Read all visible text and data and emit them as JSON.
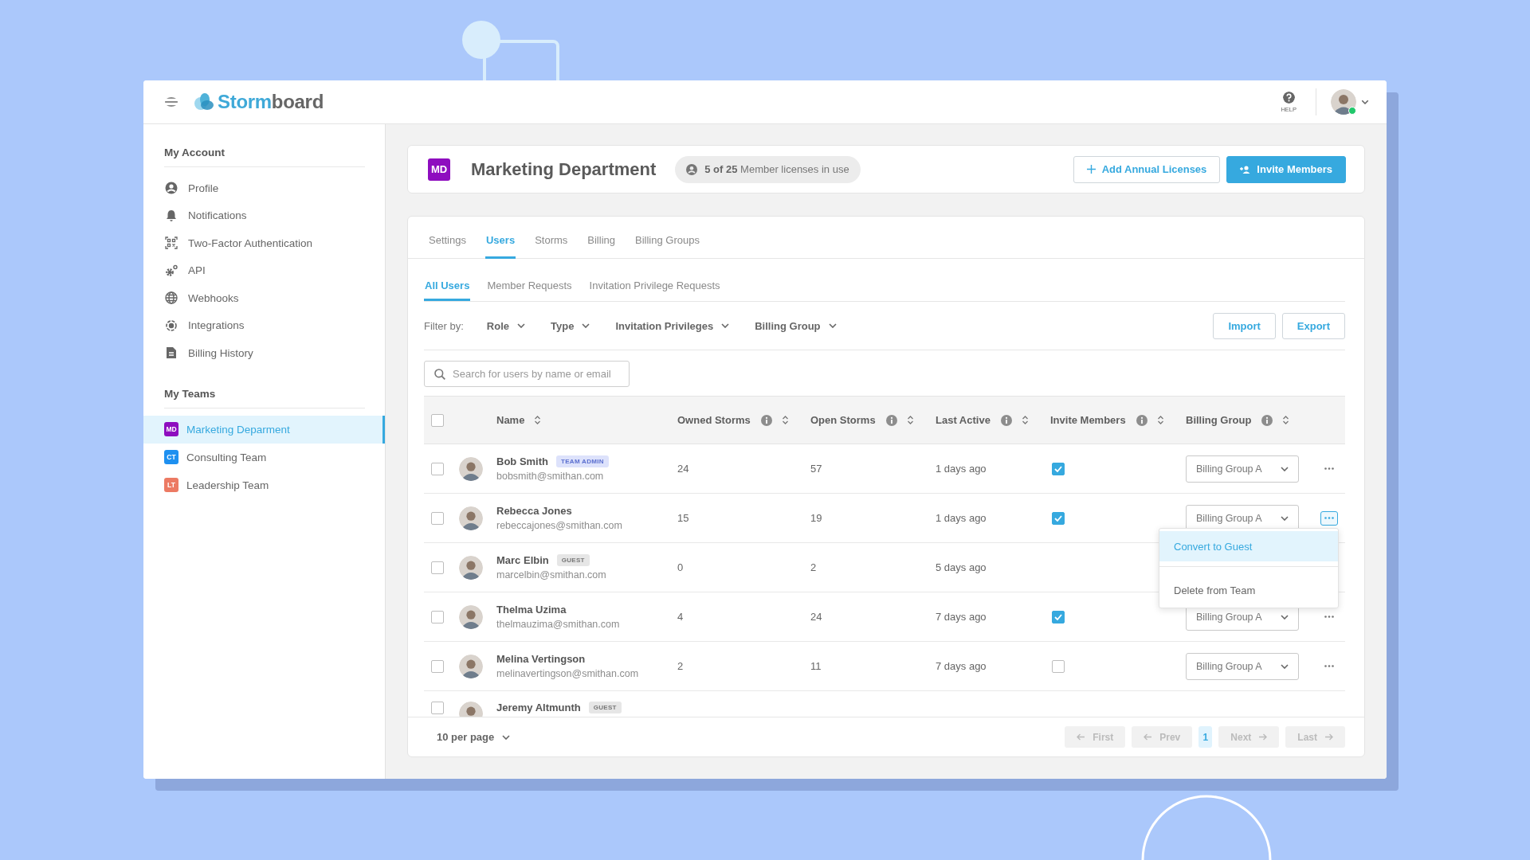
{
  "header": {
    "logo": {
      "parts": [
        {
          "text": "Storm",
          "kind": "accent"
        },
        {
          "text": "board",
          "kind": "plain"
        }
      ]
    },
    "help": {
      "label": "HELP"
    },
    "user": {
      "online": true
    }
  },
  "sidebar": {
    "account": {
      "title": "My Account",
      "items": [
        {
          "label": "Profile"
        },
        {
          "label": "Notifications"
        },
        {
          "label": "Two-Factor Authentication"
        },
        {
          "label": "API"
        },
        {
          "label": "Webhooks"
        },
        {
          "label": "Integrations"
        },
        {
          "label": "Billing History"
        }
      ]
    },
    "teams": {
      "title": "My Teams",
      "items": [
        {
          "initials": "MD",
          "label": "Marketing Deparment",
          "color": "#8e0dbf",
          "selected": true
        },
        {
          "initials": "CT",
          "label": "Consulting Team",
          "color": "#1e90f0",
          "selected": false
        },
        {
          "initials": "LT",
          "label": "Leadership Team",
          "color": "#ec7a63",
          "selected": false
        }
      ]
    }
  },
  "team": {
    "initials": "MD",
    "color": "#8e0dbf",
    "title": "Marketing Department",
    "licenses": "**5 of 25** Member licenses in use",
    "buttons": [
      {
        "label": "Add Annual Licenses",
        "kind": "outline"
      },
      {
        "label": "Invite Members",
        "kind": "primary"
      }
    ]
  },
  "tabs": [
    {
      "label": "Settings",
      "selected": false
    },
    {
      "label": "Users",
      "selected": true
    },
    {
      "label": "Storms",
      "selected": false
    },
    {
      "label": "Billing",
      "selected": false
    },
    {
      "label": "Billing Groups",
      "selected": false
    }
  ],
  "subtabs": [
    {
      "label": "All Users",
      "selected": true
    },
    {
      "label": "Member Requests",
      "selected": false
    },
    {
      "label": "Invitation Privilege Requests",
      "selected": false
    }
  ],
  "filters": {
    "label": "Filter by:",
    "items": [
      "Role",
      "Type",
      "Invitation Privileges",
      "Billing Group"
    ],
    "actions": [
      "Import",
      "Export"
    ]
  },
  "search": {
    "placeholder": "Search for users by name or email"
  },
  "table": {
    "select_all": false,
    "columns": [
      {
        "label": "Name",
        "info": false,
        "sortable": true
      },
      {
        "label": "Owned Storms",
        "info": true,
        "sortable": true
      },
      {
        "label": "Open Storms",
        "info": true,
        "sortable": true
      },
      {
        "label": "Last Active",
        "info": true,
        "sortable": true
      },
      {
        "label": "Invite Members",
        "info": true,
        "sortable": true
      },
      {
        "label": "Billing Group",
        "info": true,
        "sortable": true
      }
    ],
    "rows": [
      {
        "name": "Bob Smith",
        "badge": {
          "text": "TEAM ADMIN",
          "kind": "admin"
        },
        "email": "bobsmith@smithan.com",
        "owned": "24",
        "open": "57",
        "last_active": "1 days ago",
        "invite": true,
        "billing_group": "Billing Group A",
        "selected": false,
        "menu_open": false
      },
      {
        "name": "Rebecca Jones",
        "email": "rebeccajones@smithan.com",
        "owned": "15",
        "open": "19",
        "last_active": "1 days ago",
        "invite": true,
        "billing_group": "Billing Group A",
        "selected": false,
        "menu_open": true,
        "menu": {
          "items": [
            {
              "label": "Convert to Guest",
              "selected": true
            },
            {
              "label": "Delete from Team",
              "selected": false
            }
          ]
        }
      },
      {
        "name": "Marc Elbin",
        "badge": {
          "text": "GUEST",
          "kind": "guest"
        },
        "email": "marcelbin@smithan.com",
        "owned": "0",
        "open": "2",
        "last_active": "5 days ago",
        "selected": false
      },
      {
        "name": "Thelma Uzima",
        "email": "thelmauzima@smithan.com",
        "owned": "4",
        "open": "24",
        "last_active": "7 days ago",
        "invite": true,
        "billing_group": "Billing Group A",
        "selected": false,
        "menu_open": false
      },
      {
        "name": "Melina Vertingson",
        "email": "melinavertingson@smithan.com",
        "owned": "2",
        "open": "11",
        "last_active": "7 days ago",
        "invite": false,
        "billing_group": "Billing Group A",
        "selected": false,
        "menu_open": false
      },
      {
        "name": "Jeremy Altmunth",
        "badge": {
          "text": "GUEST",
          "kind": "guest"
        },
        "selected": false
      }
    ]
  },
  "footer": {
    "per_page": "10 per page",
    "pages": [
      {
        "label": "First",
        "kind": "first",
        "disabled": true,
        "selected": false
      },
      {
        "label": "Prev",
        "kind": "prev",
        "disabled": true,
        "selected": false
      },
      {
        "label": "1",
        "kind": "page",
        "disabled": false,
        "selected": true
      },
      {
        "label": "Next",
        "kind": "next",
        "disabled": true,
        "selected": false
      },
      {
        "label": "Last",
        "kind": "last",
        "disabled": true,
        "selected": false
      }
    ]
  }
}
